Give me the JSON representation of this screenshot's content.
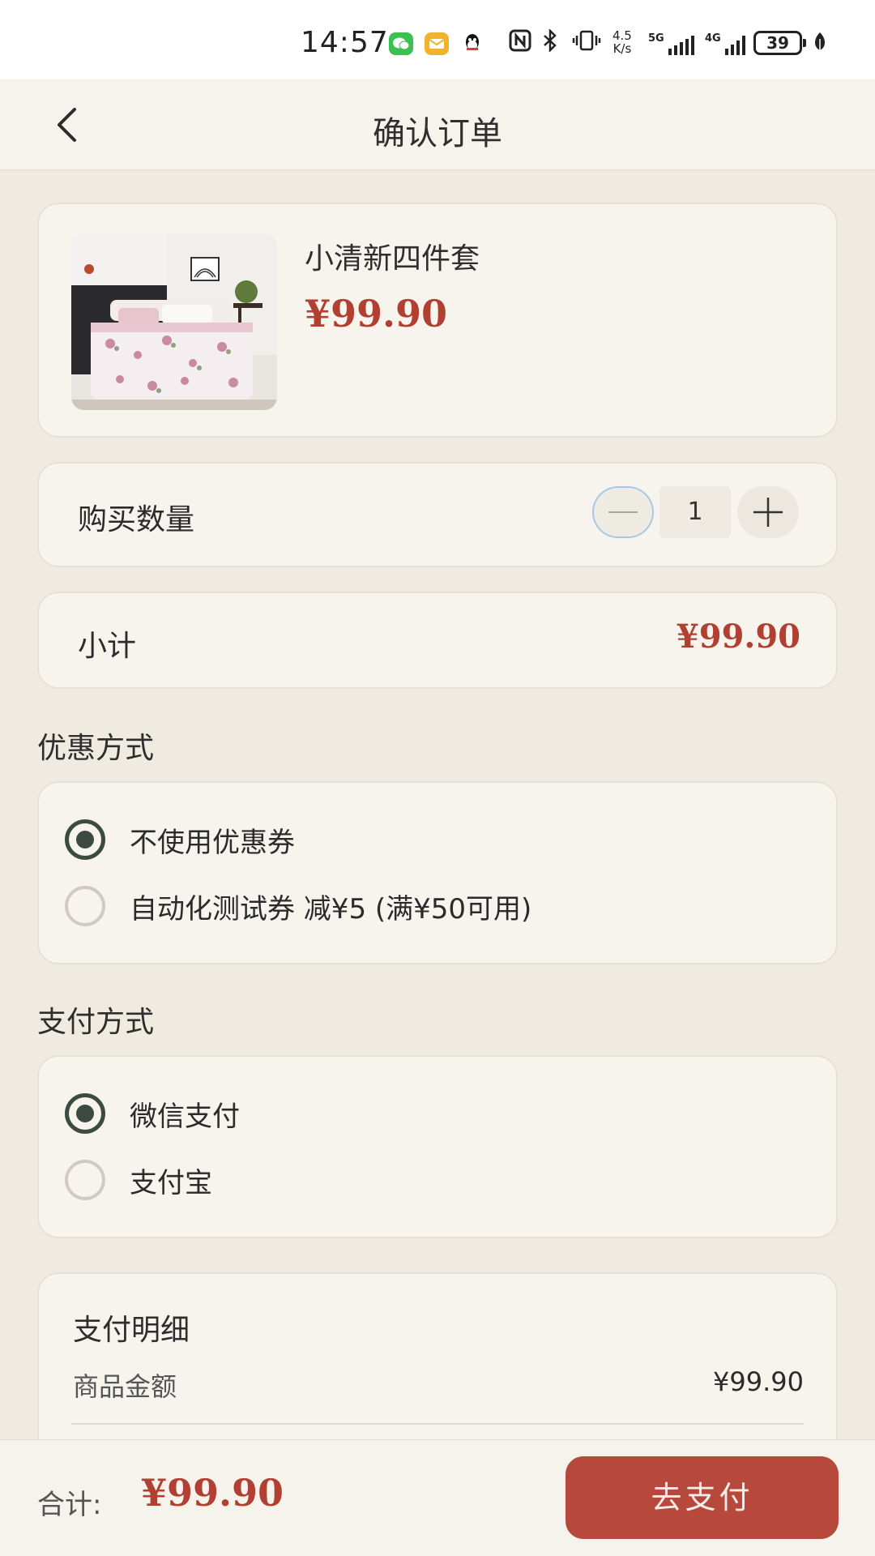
{
  "status_bar": {
    "time": "14:57",
    "net_speed": "4.5",
    "net_speed_unit": "K/s",
    "network_5g": "5G",
    "network_4g": "4G",
    "battery": "39"
  },
  "header": {
    "title": "确认订单"
  },
  "product": {
    "name": "小清新四件套",
    "price": "¥99.90"
  },
  "quantity": {
    "label": "购买数量",
    "value": "1"
  },
  "subtotal": {
    "label": "小计",
    "value": "¥99.90"
  },
  "coupon": {
    "section_title": "优惠方式",
    "options": [
      {
        "label": "不使用优惠券",
        "selected": true
      },
      {
        "label": "自动化测试券 减¥5 (满¥50可用)",
        "selected": false
      }
    ]
  },
  "payment": {
    "section_title": "支付方式",
    "options": [
      {
        "label": "微信支付",
        "selected": true
      },
      {
        "label": "支付宝",
        "selected": false
      }
    ]
  },
  "payment_detail": {
    "title": "支付明细",
    "rows": [
      {
        "label": "商品金额",
        "value": "¥99.90"
      }
    ]
  },
  "footer": {
    "total_label": "合计:",
    "total_value": "¥99.90",
    "pay_button_label": "去支付"
  },
  "colors": {
    "accent": "#B24032",
    "background": "#EFEBE1",
    "card": "#F7F4EE",
    "radio_checked": "#3C4A42"
  }
}
